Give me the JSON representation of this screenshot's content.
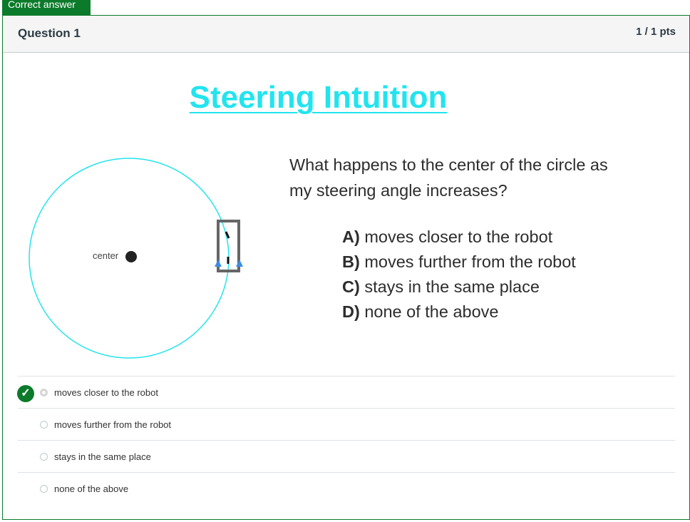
{
  "status_tag": "Correct answer",
  "question": {
    "title": "Question 1",
    "points": "1 / 1 pts"
  },
  "slide": {
    "title": "Steering Intuition",
    "center_label": "center",
    "question_text": "What happens to the center of the circle as my steering angle increases?",
    "options": [
      {
        "letter": "A)",
        "text": " moves closer to the robot"
      },
      {
        "letter": "B)",
        "text": " moves further from the robot"
      },
      {
        "letter": "C)",
        "text": " stays in the same place"
      },
      {
        "letter": "D)",
        "text": " none of the above"
      }
    ],
    "colors": {
      "circle": "#22e4ef",
      "robot_frame": "#555555",
      "wheel_arrows": "#3b8de0"
    }
  },
  "answers": [
    {
      "label": "moves closer to the robot",
      "selected": true,
      "correct": true
    },
    {
      "label": "moves further from the robot",
      "selected": false
    },
    {
      "label": "stays in the same place",
      "selected": false
    },
    {
      "label": "none of the above",
      "selected": false
    }
  ],
  "icons": {
    "correct_marker": "check-icon"
  }
}
